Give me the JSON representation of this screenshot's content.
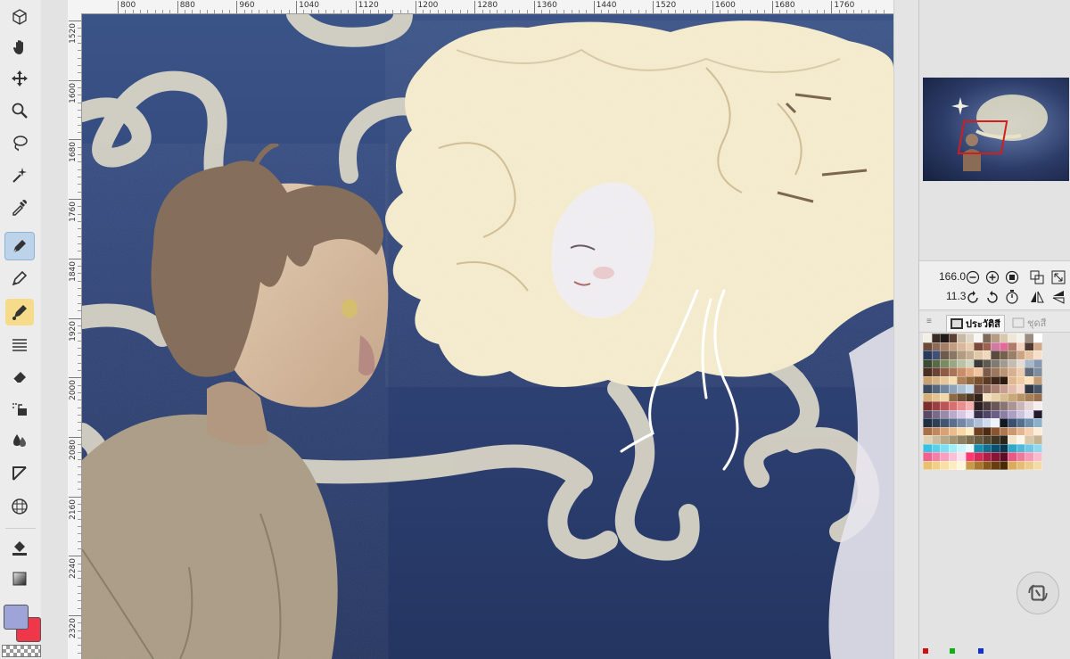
{
  "ruler": {
    "top_labels": [
      "800",
      "880",
      "960",
      "1040",
      "1120",
      "1200",
      "1280",
      "1360",
      "1440",
      "1520",
      "1600",
      "1680",
      "1760"
    ],
    "left_labels": [
      "1520",
      "1600",
      "1680",
      "1760",
      "1840",
      "1920",
      "2000",
      "2080",
      "2160",
      "2240",
      "2320"
    ]
  },
  "tools": [
    {
      "name": "object-selection-icon",
      "active": false
    },
    {
      "name": "hand-tool-icon",
      "active": false
    },
    {
      "name": "move-tool-icon",
      "active": false
    },
    {
      "name": "zoom-tool-icon",
      "active": false
    },
    {
      "name": "lasso-tool-icon",
      "active": false
    },
    {
      "name": "magic-wand-icon",
      "active": false
    },
    {
      "name": "eyedropper-icon",
      "active": false
    },
    {
      "name": "pen-tool-icon",
      "active": true
    },
    {
      "name": "pencil-tool-icon",
      "active": false
    },
    {
      "name": "brush-tool-icon",
      "active": false
    },
    {
      "name": "hatching-icon",
      "active": false
    },
    {
      "name": "eraser-icon",
      "active": false
    },
    {
      "name": "fill-bucket-icon",
      "active": false
    },
    {
      "name": "blend-tool-icon",
      "active": false
    },
    {
      "name": "ruler-shape-icon",
      "active": false
    },
    {
      "name": "mesh-transform-icon",
      "active": false
    },
    {
      "name": "fill-tool-icon",
      "active": false
    },
    {
      "name": "gradient-tool-icon",
      "active": false
    }
  ],
  "colors": {
    "foreground": "#9ea4d8",
    "background": "#f0364b",
    "canvas_bg": "#2f4478"
  },
  "navigator": {
    "zoom": "166.0",
    "angle": "11.3"
  },
  "palette_tabs": {
    "history": "ประวัติสี",
    "sets": "ชุดสี"
  },
  "palette_colors": [
    "#f2efe6",
    "#3a2a24",
    "#1f1a18",
    "#5a4032",
    "#c8b9a6",
    "#e0d6c8",
    "#f8f6f2",
    "#7b6a5a",
    "#b59c84",
    "#d8c6ae",
    "#efe6d8",
    "#f5f2ea",
    "#9a8c80",
    "#ffffff",
    "#6b4a3a",
    "#8a6c58",
    "#a47e66",
    "#c29c80",
    "#d8b89a",
    "#e8ccb0",
    "#7a4a3a",
    "#9c6250",
    "#d07aa0",
    "#e26a9a",
    "#b07b6a",
    "#f2d2c0",
    "#4e3a30",
    "#cfa98a",
    "#2a3a5a",
    "#40507a",
    "#6c5a4a",
    "#8a7664",
    "#b49a7e",
    "#c6ae92",
    "#e2c8a8",
    "#f0d8bc",
    "#5a4a3e",
    "#76604e",
    "#9a806a",
    "#caa484",
    "#e6c4a2",
    "#f6e0c8",
    "#384a32",
    "#5a6a48",
    "#7c8a64",
    "#9aa684",
    "#b8c2a4",
    "#d0d6c0",
    "#3c3a36",
    "#5e5a52",
    "#807a70",
    "#a29a8e",
    "#c4bcb0",
    "#e2dcd2",
    "#a8b8c8",
    "#8898b0",
    "#4a2e22",
    "#6a4434",
    "#8c5c46",
    "#aa7458",
    "#c88e6c",
    "#e2a882",
    "#f2c49e",
    "#7a5c48",
    "#9c785e",
    "#bc9474",
    "#d6b090",
    "#ecccae",
    "#5e6a7a",
    "#7e8c9e",
    "#c8a070",
    "#d8b484",
    "#e8c898",
    "#f6dcae",
    "#b08058",
    "#94683e",
    "#785030",
    "#5c3a22",
    "#402818",
    "#2a1a10",
    "#e0b890",
    "#f0cca4",
    "#ffe0b8",
    "#c49c74",
    "#3c4a5e",
    "#56687e",
    "#72869e",
    "#8ea2ba",
    "#aabed4",
    "#c6d8ec",
    "#6a4c40",
    "#8a665a",
    "#aa8274",
    "#c89e90",
    "#e4bcae",
    "#f4d6c8",
    "#2e3844",
    "#48566a",
    "#d4b078",
    "#e4c490",
    "#f2d8a8",
    "#8c6a46",
    "#6c5034",
    "#4e3824",
    "#30221a",
    "#f0e0c0",
    "#e8d0a8",
    "#d8bc90",
    "#c8a878",
    "#b89468",
    "#a8805a",
    "#987050",
    "#7a2e2e",
    "#9a4040",
    "#ba5656",
    "#d87070",
    "#ea8e8e",
    "#f6b0b0",
    "#2a1e1e",
    "#4a3a3a",
    "#6a5656",
    "#8a7474",
    "#aa9494",
    "#cab6b6",
    "#e6d6d6",
    "#f6eeee",
    "#5a4a68",
    "#7a6a8a",
    "#9a8aaa",
    "#bcaacc",
    "#d8c8e6",
    "#eee4f6",
    "#383048",
    "#504468",
    "#6c5e84",
    "#8c7ea4",
    "#aca0c2",
    "#ccc2de",
    "#e6e0f0",
    "#201a2a",
    "#1e2e40",
    "#2e4058",
    "#425672",
    "#5a6e8c",
    "#7488a6",
    "#90a2c0",
    "#b0c0da",
    "#d0dcee",
    "#eef2fa",
    "#101824",
    "#3a5070",
    "#52708e",
    "#6e90ac",
    "#8cb0ca",
    "#a87048",
    "#c0885c",
    "#d8a272",
    "#ecbc8a",
    "#f8d6a6",
    "#ffeec4",
    "#6c4020",
    "#4a2a12",
    "#8a5430",
    "#b07850",
    "#cc9870",
    "#e4b690",
    "#f4d2b0",
    "#fcecd8",
    "#e0d0b4",
    "#ccbc9e",
    "#b8a888",
    "#a49474",
    "#908060",
    "#7c6c4e",
    "#685a3e",
    "#544830",
    "#403622",
    "#2c2416",
    "#f0e4cc",
    "#fcf6e8",
    "#d8c8a8",
    "#c4b290",
    "#3ac0e0",
    "#58d0ea",
    "#7ae0f2",
    "#a0eef8",
    "#c8f6fc",
    "#e8fcfe",
    "#1a90b0",
    "#107090",
    "#0a5070",
    "#063850",
    "#32a8c8",
    "#50b8d8",
    "#70c8e4",
    "#90d8ee",
    "#f06090",
    "#f480a8",
    "#f8a0c0",
    "#fcc0d6",
    "#fee0ec",
    "#ff3a70",
    "#d82a5a",
    "#b01e48",
    "#881436",
    "#600c26",
    "#e85a84",
    "#f07a9c",
    "#f89ab6",
    "#fcbacf",
    "#e8c070",
    "#f0d088",
    "#f8e0a4",
    "#fcecc0",
    "#fff6dc",
    "#c89a48",
    "#a8782c",
    "#88581a",
    "#683e0e",
    "#482a06",
    "#d8ac5c",
    "#e4bc74",
    "#eccc8c",
    "#f4dca6"
  ]
}
